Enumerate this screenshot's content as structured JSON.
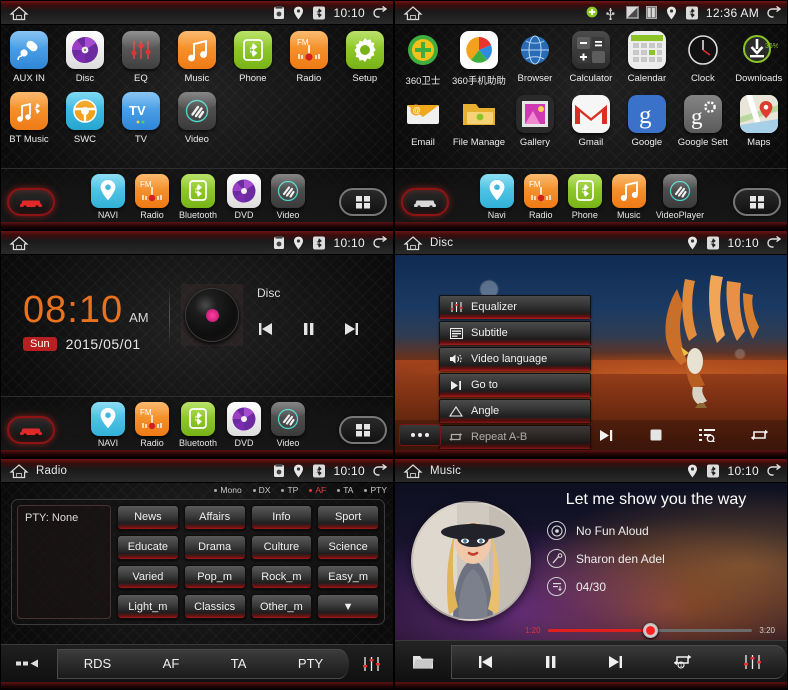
{
  "panels": {
    "home_apps": {
      "status": {
        "title": "",
        "time": "10:10",
        "icons": [
          "sim-card-icon",
          "location-pin-icon",
          "bluetooth-icon"
        ],
        "back_icon": "back-arrow-icon",
        "home_icon": "home-icon"
      },
      "apps_row1": [
        {
          "label": "AUX IN",
          "icon": "aux-plug-icon",
          "color": "#3c9ae8"
        },
        {
          "label": "Disc",
          "icon": "disc-icon",
          "color": "#f2f2f2"
        },
        {
          "label": "EQ",
          "icon": "equalizer-icon",
          "color": "#5a5a5a"
        },
        {
          "label": "Music",
          "icon": "music-note-icon",
          "color": "#f58a26"
        },
        {
          "label": "Phone",
          "icon": "bluetooth-phone-icon",
          "color": "#8cc428"
        },
        {
          "label": "Radio",
          "icon": "fm-radio-icon",
          "color": "#f58a26"
        },
        {
          "label": "Setup",
          "icon": "gear-icon",
          "color": "#8cc428"
        }
      ],
      "apps_row2": [
        {
          "label": "BT Music",
          "icon": "bt-music-icon",
          "color": "#f58a26"
        },
        {
          "label": "SWC",
          "icon": "steering-wheel-icon",
          "color": "#34b5d8"
        },
        {
          "label": "TV",
          "icon": "tv-icon",
          "color": "#3c9ae8"
        },
        {
          "label": "Video",
          "icon": "video-icon",
          "color": "#4a4a4a"
        }
      ],
      "dock": [
        {
          "label": "NAVI",
          "icon": "location-pin-icon",
          "color": "#4ec0e0"
        },
        {
          "label": "Radio",
          "icon": "fm-radio-icon",
          "color": "#f58a26"
        },
        {
          "label": "Bluetooth",
          "icon": "bluetooth-icon",
          "color": "#8cc428"
        },
        {
          "label": "DVD",
          "icon": "disc-icon",
          "color": "#f2f2f2"
        },
        {
          "label": "Video",
          "icon": "video-icon",
          "color": "#4a4a4a"
        }
      ],
      "dock_left_icon": "car-icon",
      "dock_right_icon": "app-grid-icon"
    },
    "android_apps": {
      "status": {
        "title": "",
        "time": "12:36 AM",
        "icons": [
          "android-update-icon",
          "usb-icon",
          "sd-card-icon",
          "battery-icon",
          "location-pin-icon",
          "bluetooth-icon"
        ],
        "back_icon": "back-arrow-icon",
        "home_icon": "home-icon"
      },
      "apps_row1": [
        {
          "label": "360卫士",
          "icon": "360-guard-icon",
          "color": "#e8b722"
        },
        {
          "label": "360手机助助",
          "icon": "360-assistant-icon",
          "color": "#ffffff"
        },
        {
          "label": "Browser",
          "icon": "browser-globe-icon",
          "color": "#2b6fb5"
        },
        {
          "label": "Calculator",
          "icon": "calculator-icon",
          "color": "#3c3c3c"
        },
        {
          "label": "Calendar",
          "icon": "calendar-icon",
          "color": "#e0e0e0"
        },
        {
          "label": "Clock",
          "icon": "clock-icon",
          "color": "#141414"
        },
        {
          "label": "Downloads",
          "icon": "downloads-icon",
          "color": "#2e2e2e",
          "badge": "36%"
        }
      ],
      "apps_row2": [
        {
          "label": "Email",
          "icon": "email-icon",
          "color": "#e8a020"
        },
        {
          "label": "File Manage",
          "icon": "file-manager-icon",
          "color": "#e8b030"
        },
        {
          "label": "Gallery",
          "icon": "gallery-icon",
          "color": "#2a2a2a"
        },
        {
          "label": "Gmail",
          "icon": "gmail-icon",
          "color": "#f4f4f4"
        },
        {
          "label": "Google",
          "icon": "google-search-icon",
          "color": "#3b72c9"
        },
        {
          "label": "Google Sett",
          "icon": "google-settings-icon",
          "color": "#6e6e6e"
        },
        {
          "label": "Maps",
          "icon": "maps-icon",
          "color": "#d8d8d0"
        }
      ],
      "dock": [
        {
          "label": "Navi",
          "icon": "location-pin-icon",
          "color": "#4ec0e0"
        },
        {
          "label": "Radio",
          "icon": "fm-radio-icon",
          "color": "#f58a26"
        },
        {
          "label": "Phone",
          "icon": "bluetooth-phone-icon",
          "color": "#8cc428"
        },
        {
          "label": "Music",
          "icon": "music-note-icon",
          "color": "#f58a26"
        },
        {
          "label": "VideoPlayer",
          "icon": "video-icon",
          "color": "#4a4a4a"
        }
      ],
      "dock_left_icon": "car-icon",
      "dock_right_icon": "app-grid-icon"
    },
    "clock_home": {
      "status": {
        "title": "",
        "time": "10:10",
        "icons": [
          "sim-card-icon",
          "location-pin-icon",
          "bluetooth-icon"
        ]
      },
      "clock": {
        "time": "08:10",
        "meridiem": "AM",
        "weekday": "Sun",
        "date": "2015/05/01",
        "accent": "#e8721d",
        "day_badge_color": "#b62020"
      },
      "now_playing": {
        "source": "Disc",
        "prev_icon": "prev-track-icon",
        "pause_icon": "pause-icon",
        "next_icon": "next-track-icon"
      },
      "dock": [
        {
          "label": "NAVI",
          "icon": "location-pin-icon",
          "color": "#4ec0e0"
        },
        {
          "label": "Radio",
          "icon": "fm-radio-icon",
          "color": "#f58a26"
        },
        {
          "label": "Bluetooth",
          "icon": "bluetooth-icon",
          "color": "#8cc428"
        },
        {
          "label": "DVD",
          "icon": "disc-icon",
          "color": "#f2f2f2"
        },
        {
          "label": "Video",
          "icon": "video-icon",
          "color": "#4a4a4a"
        }
      ]
    },
    "disc": {
      "status": {
        "title": "Disc",
        "time": "10:10",
        "icons": [
          "location-pin-icon",
          "bluetooth-icon"
        ]
      },
      "menu": [
        {
          "label": "Equalizer",
          "icon": "equalizer-icon"
        },
        {
          "label": "Subtitle",
          "icon": "subtitle-icon"
        },
        {
          "label": "Video language",
          "icon": "audio-language-icon"
        },
        {
          "label": "Go to",
          "icon": "goto-icon"
        },
        {
          "label": "Angle",
          "icon": "angle-icon"
        },
        {
          "label": "Repeat A-B",
          "icon": "repeat-ab-icon"
        }
      ],
      "controls": [
        "more-dots-icon",
        "next-track-icon",
        "stop-icon",
        "playlist-icon",
        "repeat-icon"
      ]
    },
    "radio": {
      "status": {
        "title": "Radio",
        "time": "10:10",
        "icons": [
          "sim-card-icon",
          "location-pin-icon",
          "bluetooth-icon"
        ]
      },
      "indicators": [
        {
          "label": "Mono",
          "active": false
        },
        {
          "label": "DX",
          "active": false
        },
        {
          "label": "TP",
          "active": false
        },
        {
          "label": "AF",
          "active": true
        },
        {
          "label": "TA",
          "active": false
        },
        {
          "label": "PTY",
          "active": false
        }
      ],
      "pty_label": "PTY:",
      "pty_value": "None",
      "pty_buttons": [
        "News",
        "Affairs",
        "Info",
        "Sport",
        "Educate",
        "Drama",
        "Culture",
        "Science",
        "Varied",
        "Pop_m",
        "Rock_m",
        "Easy_m",
        "Light_m",
        "Classics",
        "Other_m",
        "▼"
      ],
      "tabs": [
        "RDS",
        "AF",
        "TA",
        "PTY"
      ],
      "tab_left_icon": "back-dots-icon",
      "tab_right_icon": "equalizer-icon"
    },
    "music": {
      "status": {
        "title": "Music",
        "time": "10:10",
        "icons": [
          "location-pin-icon",
          "bluetooth-icon"
        ]
      },
      "track": {
        "title": "Let me show you the way",
        "album": "No Fun Aloud",
        "artist": "Sharon den Adel",
        "track_number": "04/30",
        "album_icon": "album-disc-icon",
        "artist_icon": "artist-icon",
        "track_icon": "track-number-icon"
      },
      "progress": {
        "current": "1:20",
        "total": "3:20",
        "percent": 50,
        "fill_color": "#e01f1f"
      },
      "controls": [
        "folder-icon",
        "prev-track-icon",
        "pause-icon",
        "next-track-icon",
        "repeat-one-icon",
        "equalizer-icon"
      ]
    }
  }
}
